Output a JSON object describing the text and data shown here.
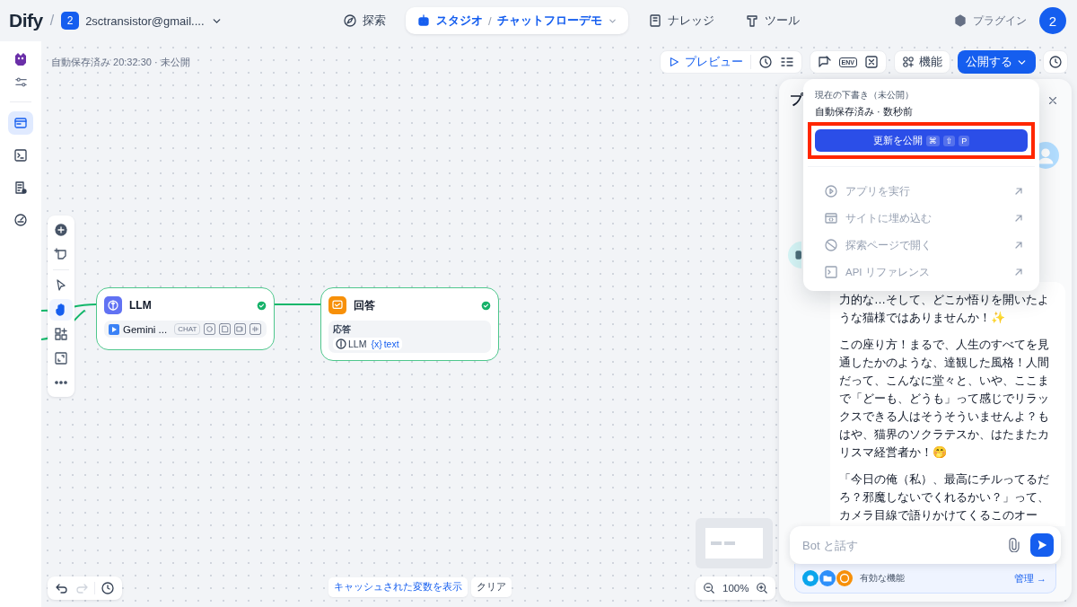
{
  "topbar": {
    "logo": "Dify",
    "logo_separator": "/",
    "workspace": {
      "badge": "2",
      "name": "2sctransistor@gmail...."
    },
    "nav": [
      {
        "label": "探索",
        "selected": false
      },
      {
        "label": "スタジオ",
        "selected": true,
        "app_separator": "/",
        "app": "チャットフローデモ"
      },
      {
        "label": "ナレッジ",
        "selected": false
      },
      {
        "label": "ツール",
        "selected": false
      }
    ],
    "plugins": "プラグイン",
    "avatar": "2"
  },
  "sidebar": {
    "items": [
      {
        "selected": true
      },
      {
        "selected": false
      },
      {
        "selected": false
      },
      {
        "selected": false
      }
    ]
  },
  "canvas": {
    "autosave": "自動保存済み 20:32:30 · 未公開",
    "toolbar": {
      "preview": "プレビュー",
      "env": "ENV",
      "features": "機能",
      "publish": "公開する"
    },
    "tools": [
      {
        "selected": false
      },
      {
        "selected": false
      },
      {
        "selected": false
      },
      {
        "selected": true
      },
      {
        "selected": false
      },
      {
        "selected": false
      },
      {
        "selected": false
      }
    ],
    "nodes": [
      {
        "kind": "llm",
        "title": "LLM",
        "valid": true,
        "model": "Gemini ...",
        "mode": "CHAT"
      },
      {
        "kind": "answer",
        "title": "回答",
        "valid": true,
        "field_label": "応答",
        "source": "LLM",
        "var_icon": "{x}",
        "variable": "text"
      }
    ],
    "redo_disabled": true,
    "cache_button": "キャッシュされた変数を表示",
    "clear_button": "クリア",
    "zoom": "100%"
  },
  "publish_menu": {
    "status": "現在の下書き（未公開）",
    "saved": "自動保存済み · 数秒前",
    "highlighted": true,
    "button": "更新を公開",
    "shortcut": [
      "⌘",
      "⇧",
      "P"
    ],
    "items": [
      {
        "label": "アプリを実行",
        "disabled": true
      },
      {
        "label": "サイトに埋め込む",
        "disabled": true
      },
      {
        "label": "探索ページで開く",
        "disabled": true
      },
      {
        "label": "API リファレンス",
        "disabled": true
      }
    ]
  },
  "chat": {
    "title": "プ",
    "paragraphs": [
      "力的な…そして、どこか悟りを開いたような猫様ではありませんか！✨",
      "この座り方！まるで、人生のすべてを見通したかのような、達観した風格！人間だって、こんなに堂々と、いや、ここまで「どーも、どうも」って感じでリラックスできる人はそうそういませんよ？もはや、猫界のソクラテスか、はたまたカリスマ経営者か！🤭",
      "「今日の俺（私）、最高にチルってるだろ？邪魔しないでくれるかい？」って、カメラ目線で語りかけてくるこのオー"
    ],
    "input": {
      "placeholder": "Bot と話す"
    },
    "features": {
      "label": "有効な機能",
      "manage": "管理 →"
    }
  }
}
